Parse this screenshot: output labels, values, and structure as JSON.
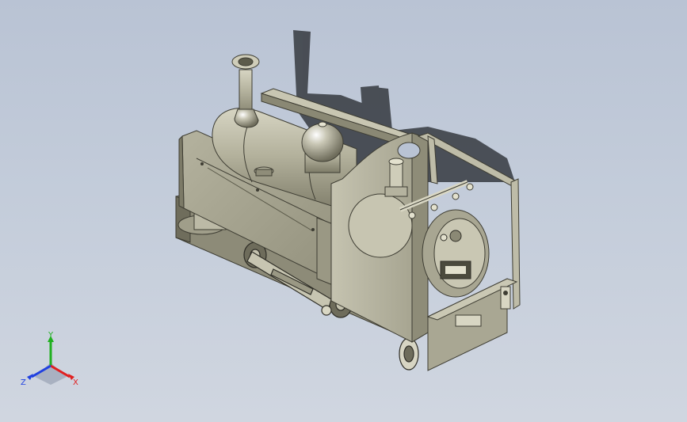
{
  "viewport": {
    "background_top": "#b9c3d4",
    "background_bottom": "#d0d6e0"
  },
  "model": {
    "icon": "steam-locomotive-model",
    "body_color": "#a7a590",
    "shadow_color": "#3d4148"
  },
  "triad": {
    "x_label": "X",
    "y_label": "Y",
    "z_label": "Z",
    "x_color": "#e02020",
    "y_color": "#20b020",
    "z_color": "#2040e0"
  }
}
